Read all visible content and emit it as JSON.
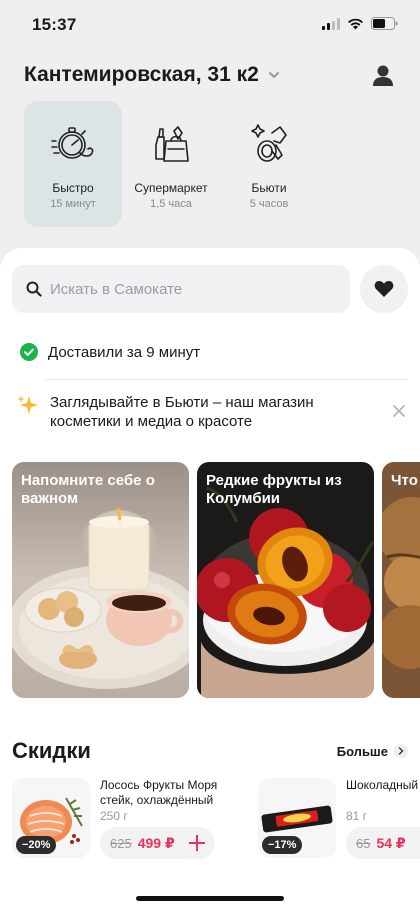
{
  "status_bar": {
    "time": "15:37"
  },
  "header": {
    "address": "Кантемировская, 31 к2"
  },
  "services": [
    {
      "name": "Быстро",
      "time": "15 минут",
      "icon": "stopwatch-icon",
      "active": true
    },
    {
      "name": "Супермаркет",
      "time": "1,5 часа",
      "icon": "grocery-bag-icon",
      "active": false
    },
    {
      "name": "Бьюти",
      "time": "5 часов",
      "icon": "cosmetics-icon",
      "active": false
    }
  ],
  "search": {
    "placeholder": "Искать в Самокате"
  },
  "delivered": {
    "text": "Доставили за 9 минут"
  },
  "promo": {
    "text": "Заглядывайте в Бьюти – наш магазин косметики и медиа о красоте"
  },
  "stories": [
    {
      "title": "Напомните себе о важном"
    },
    {
      "title": "Редкие фрукты из Колумбии"
    },
    {
      "title": "Что наш"
    }
  ],
  "discounts": {
    "title": "Скидки",
    "more": "Больше",
    "products": [
      {
        "name": "Лосось Фрукты Моря стейк, охлаждённый",
        "weight": "250 г",
        "old_price": "625",
        "new_price": "499 ₽",
        "badge": "−20%"
      },
      {
        "name": "Шоколадный Mars max",
        "weight": "81 г",
        "old_price": "65",
        "new_price": "54 ₽",
        "badge": "−17%"
      }
    ]
  },
  "colors": {
    "accent": "#e8315c",
    "success": "#1fb14a",
    "active_service_bg": "#dce4e6"
  }
}
